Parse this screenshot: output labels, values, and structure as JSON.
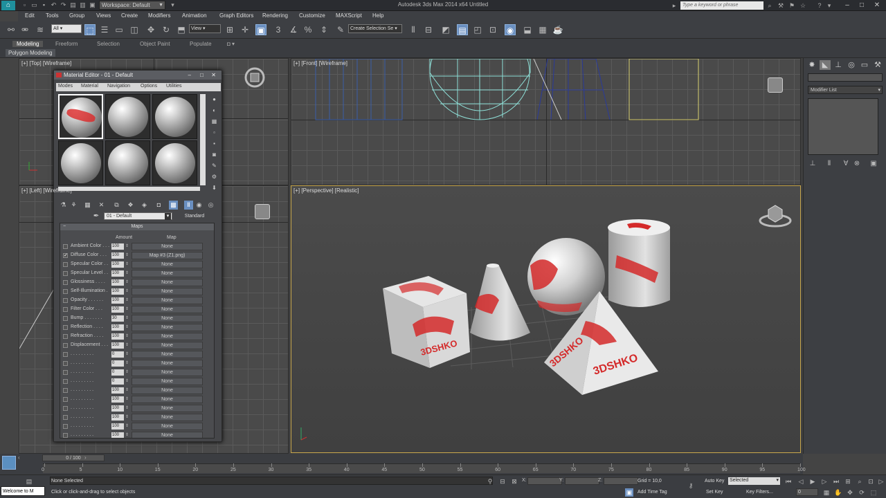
{
  "titlebar": {
    "workspace": "Workspace: Default",
    "title": "Autodesk 3ds Max 2014 x64     Untitled",
    "search_placeholder": "Type a keyword or phrase"
  },
  "menubar": [
    "Edit",
    "Tools",
    "Group",
    "Views",
    "Create",
    "Modifiers",
    "Animation",
    "Graph Editors",
    "Rendering",
    "Customize",
    "MAXScript",
    "Help"
  ],
  "toolbar": {
    "filter": "All",
    "ref_coord": "View",
    "named_selection": "Create Selection Se"
  },
  "ribbon": {
    "tabs": [
      "Modeling",
      "Freeform",
      "Selection",
      "Object Paint",
      "Populate"
    ],
    "sub": "Polygon Modeling"
  },
  "viewports": {
    "top": "[+] [Top] [Wireframe]",
    "front": "[+] [Front] [Wireframe]",
    "left": "[+] [Left] [Wireframe]",
    "perspective": "[+] [Perspective] [Realistic]"
  },
  "scene": {
    "cube_text": "3DSHKO",
    "pyramid_text1": "3DSHKO",
    "pyramid_text2": "3DSHKO"
  },
  "command_panel": {
    "modifier_list": "Modifier List"
  },
  "material_editor": {
    "title": "Material Editor - 01 - Default",
    "menus": [
      "Modes",
      "Material",
      "Navigation",
      "Options",
      "Utilities"
    ],
    "material_name": "01 - Default",
    "material_type": "Standard",
    "maps_header": "Maps",
    "col_amount": "Amount",
    "col_map": "Map",
    "rows": [
      {
        "name": "Ambient Color . . .",
        "amount": "100",
        "map": "None",
        "checked": false
      },
      {
        "name": "Diffuse Color . . .",
        "amount": "100",
        "map": "Map #3 (Z1.png)",
        "checked": true
      },
      {
        "name": "Specular Color . .",
        "amount": "100",
        "map": "None",
        "checked": false
      },
      {
        "name": "Specular Level . .",
        "amount": "100",
        "map": "None",
        "checked": false
      },
      {
        "name": "Glossiness . . . .",
        "amount": "100",
        "map": "None",
        "checked": false
      },
      {
        "name": "Self-Illumination .",
        "amount": "100",
        "map": "None",
        "checked": false
      },
      {
        "name": "Opacity . . . . . .",
        "amount": "100",
        "map": "None",
        "checked": false
      },
      {
        "name": "Filter Color . . .",
        "amount": "100",
        "map": "None",
        "checked": false
      },
      {
        "name": "Bump . . . . . . .",
        "amount": "30",
        "map": "None",
        "checked": false
      },
      {
        "name": "Reflection . . . .",
        "amount": "100",
        "map": "None",
        "checked": false
      },
      {
        "name": "Refraction . . . .",
        "amount": "100",
        "map": "None",
        "checked": false
      },
      {
        "name": "Displacement . . .",
        "amount": "100",
        "map": "None",
        "checked": false
      },
      {
        "name": ". . . . . . . . .",
        "amount": "0",
        "map": "None",
        "checked": false
      },
      {
        "name": ". . . . . . . . .",
        "amount": "0",
        "map": "None",
        "checked": false
      },
      {
        "name": ". . . . . . . . .",
        "amount": "0",
        "map": "None",
        "checked": false
      },
      {
        "name": ". . . . . . . . .",
        "amount": "0",
        "map": "None",
        "checked": false
      },
      {
        "name": ". . . . . . . . .",
        "amount": "100",
        "map": "None",
        "checked": false
      },
      {
        "name": ". . . . . . . . .",
        "amount": "100",
        "map": "None",
        "checked": false
      },
      {
        "name": ". . . . . . . . .",
        "amount": "100",
        "map": "None",
        "checked": false
      },
      {
        "name": ". . . . . . . . .",
        "amount": "100",
        "map": "None",
        "checked": false
      },
      {
        "name": ". . . . . . . . .",
        "amount": "100",
        "map": "None",
        "checked": false
      },
      {
        "name": ". . . . . . . . .",
        "amount": "100",
        "map": "None",
        "checked": false
      }
    ]
  },
  "timeline": {
    "slider": "0 / 100",
    "ticks": [
      "0",
      "5",
      "10",
      "15",
      "20",
      "25",
      "30",
      "35",
      "40",
      "45",
      "50",
      "55",
      "60",
      "65",
      "70",
      "75",
      "80",
      "85",
      "90",
      "95",
      "100"
    ]
  },
  "status": {
    "maxscript": "Welcome to M",
    "selection": "None Selected",
    "prompt": "Click or click-and-drag to select objects",
    "x_label": "X:",
    "y_label": "Y:",
    "z_label": "Z:",
    "grid": "Grid = 10,0",
    "add_time_tag": "Add Time Tag",
    "auto_key": "Auto Key",
    "set_key": "Set Key",
    "selected": "Selected",
    "key_filters": "Key Filters...",
    "frame": "0"
  },
  "colors": {
    "accent": "#6a8fc0",
    "active_viewport": "#c9a84c",
    "texture_red": "#d42a2a"
  }
}
